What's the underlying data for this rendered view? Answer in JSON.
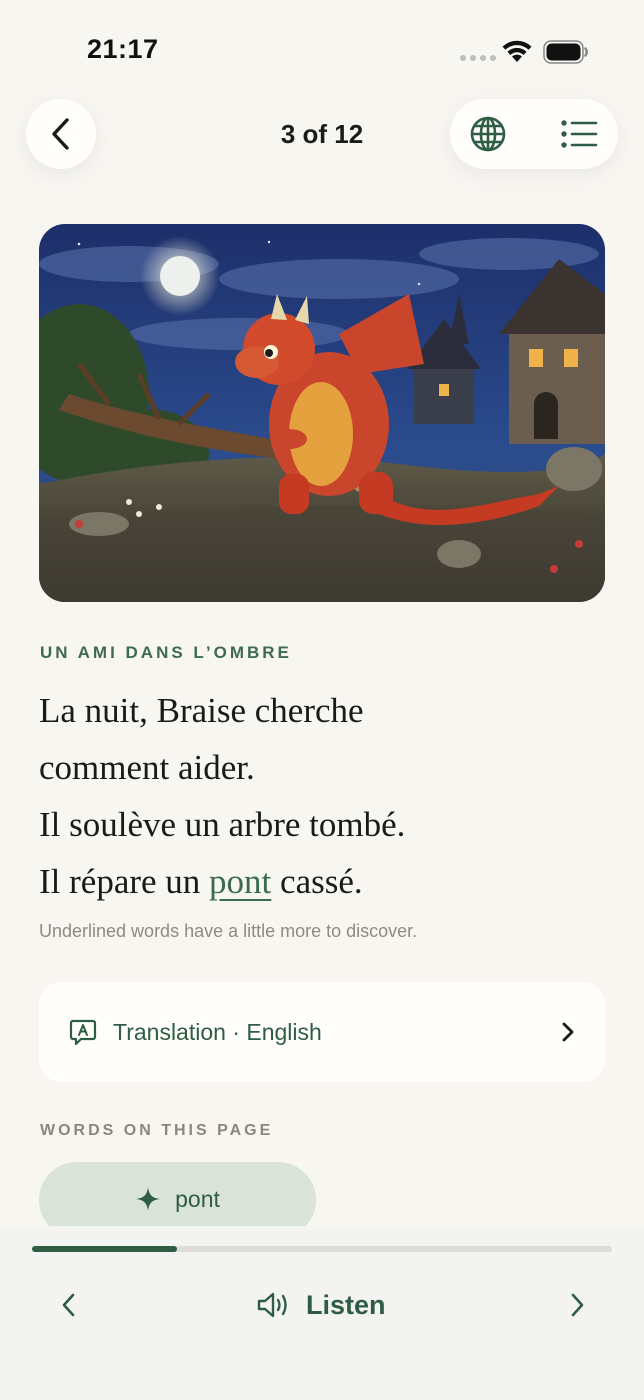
{
  "status_bar": {
    "time": "21:17"
  },
  "header": {
    "page_counter": "3 of 12"
  },
  "illustration": {
    "subject": "red dragon carrying a fallen tree at night"
  },
  "section_title": "UN AMI DANS L’OMBRE",
  "story": {
    "line1": "La nuit, Braise cherche",
    "line2": "comment aider.",
    "line3": "Il soulève un arbre tombé.",
    "line4_before": "Il répare un ",
    "line4_word": "pont",
    "line4_after": " cassé."
  },
  "hint": "Underlined words have a little more to discover.",
  "translation": {
    "label": "Translation · English"
  },
  "words": {
    "heading": "WORDS ON THIS PAGE",
    "items": [
      {
        "label": "pont"
      }
    ]
  },
  "player": {
    "listen_label": "Listen",
    "progress": 0.25
  },
  "colors": {
    "accent": "#2f5d44",
    "background": "#f8f6f1",
    "chip": "#d9e3d7"
  }
}
